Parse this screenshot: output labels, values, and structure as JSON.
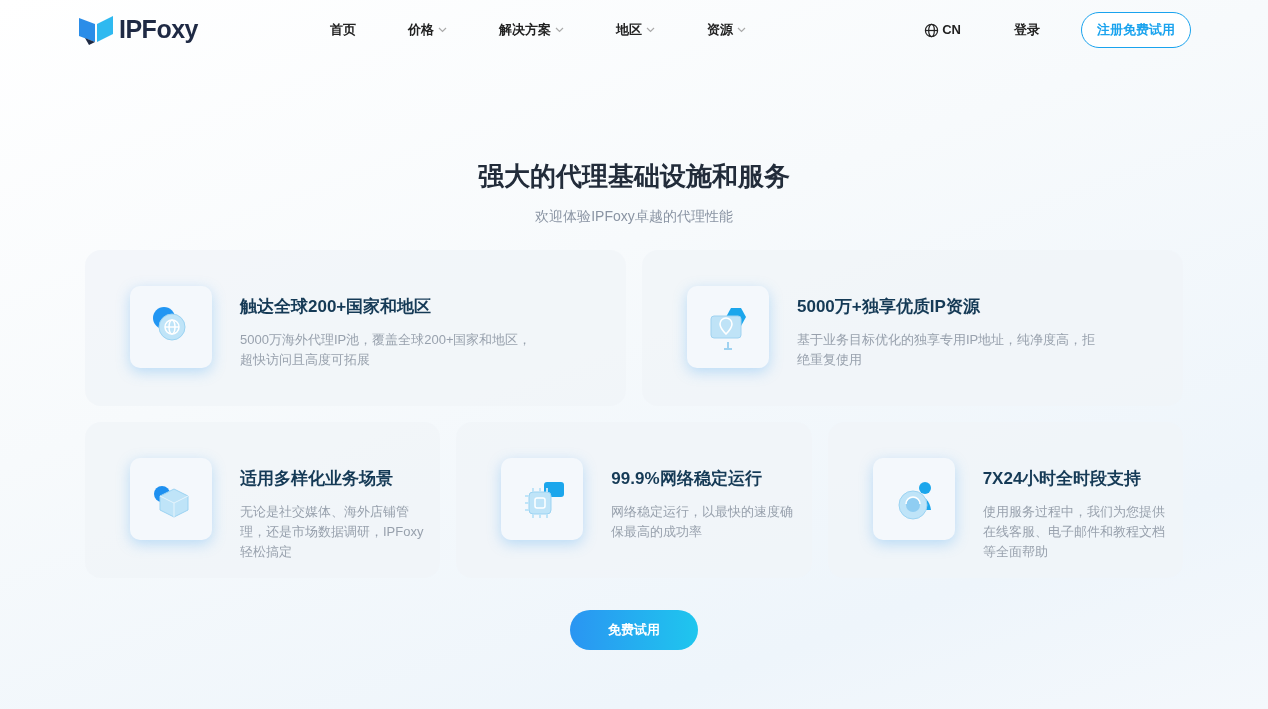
{
  "header": {
    "logo": "IPFoxy",
    "nav": [
      {
        "label": "首页",
        "has_menu": false
      },
      {
        "label": "价格",
        "has_menu": true
      },
      {
        "label": "解决方案",
        "has_menu": true
      },
      {
        "label": "地区",
        "has_menu": true
      },
      {
        "label": "资源",
        "has_menu": true
      }
    ],
    "language": "CN",
    "login": "登录",
    "signup": "注册免费试用"
  },
  "hero": {
    "title": "强大的代理基础设施和服务",
    "subtitle": "欢迎体验IPFoxy卓越的代理性能"
  },
  "features": [
    {
      "kind": "globe",
      "title": "触达全球200+国家和地区",
      "description": "5000万海外代理IP池，覆盖全球200+国家和地区，超快访问且高度可拓展"
    },
    {
      "kind": "location",
      "title": "5000万+独享优质IP资源",
      "description": "基于业务目标优化的独享专用IP地址，纯净度高，拒绝重复使用"
    },
    {
      "kind": "cube",
      "title": "适用多样化业务场景",
      "description": "无论是社交媒体、海外店铺管理，还是市场数据调研，IPFoxy轻松搞定"
    },
    {
      "kind": "chip",
      "title": "99.9%网络稳定运行",
      "description": "网络稳定运行，以最快的速度确保最高的成功率"
    },
    {
      "kind": "support",
      "title": "7X24小时全时段支持",
      "description": "使用服务过程中，我们为您提供在线客服、电子邮件和教程文档等全面帮助"
    }
  ],
  "cta": "免费试用"
}
